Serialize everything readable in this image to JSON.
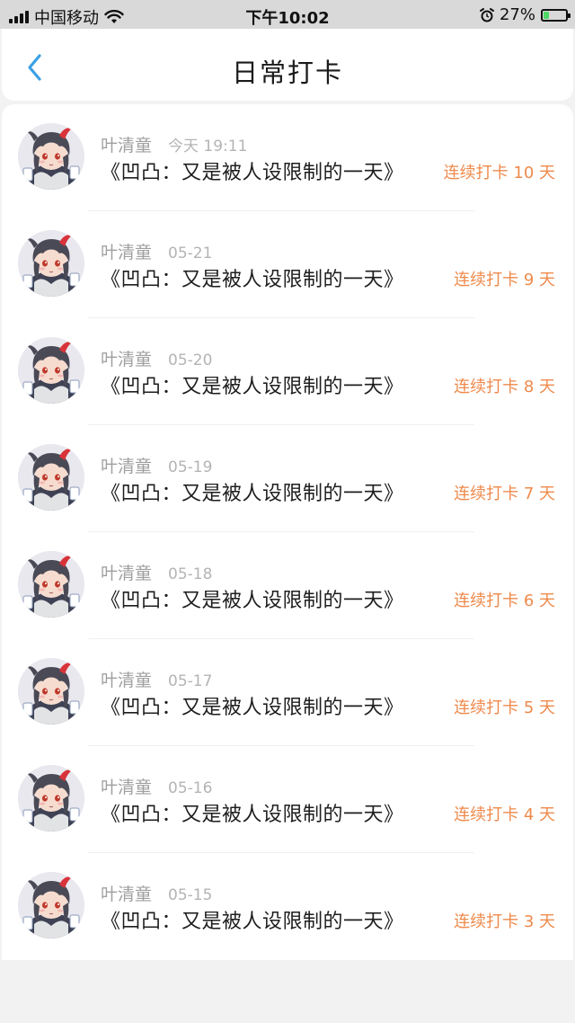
{
  "status_bar": {
    "carrier": "中国移动",
    "time": "下午10:02",
    "battery": "27%",
    "battery_level": 0.27
  },
  "header": {
    "title": "日常打卡",
    "back_icon": "chevron-left-icon",
    "accent_color": "#3aa0e6"
  },
  "colors": {
    "streak": "#ee8a4c",
    "meta": "#a0a0a0"
  },
  "items": [
    {
      "user": "叶清童",
      "date": "今天 19:11",
      "title": "《凹凸：又是被人设限制的一天》",
      "streak": "连续打卡 10 天"
    },
    {
      "user": "叶清童",
      "date": "05-21",
      "title": "《凹凸：又是被人设限制的一天》",
      "streak": "连续打卡 9 天"
    },
    {
      "user": "叶清童",
      "date": "05-20",
      "title": "《凹凸：又是被人设限制的一天》",
      "streak": "连续打卡 8 天"
    },
    {
      "user": "叶清童",
      "date": "05-19",
      "title": "《凹凸：又是被人设限制的一天》",
      "streak": "连续打卡 7 天"
    },
    {
      "user": "叶清童",
      "date": "05-18",
      "title": "《凹凸：又是被人设限制的一天》",
      "streak": "连续打卡 6 天"
    },
    {
      "user": "叶清童",
      "date": "05-17",
      "title": "《凹凸：又是被人设限制的一天》",
      "streak": "连续打卡 5 天"
    },
    {
      "user": "叶清童",
      "date": "05-16",
      "title": "《凹凸：又是被人设限制的一天》",
      "streak": "连续打卡 4 天"
    },
    {
      "user": "叶清童",
      "date": "05-15",
      "title": "《凹凸：又是被人设限制的一天》",
      "streak": "连续打卡 3 天"
    }
  ]
}
